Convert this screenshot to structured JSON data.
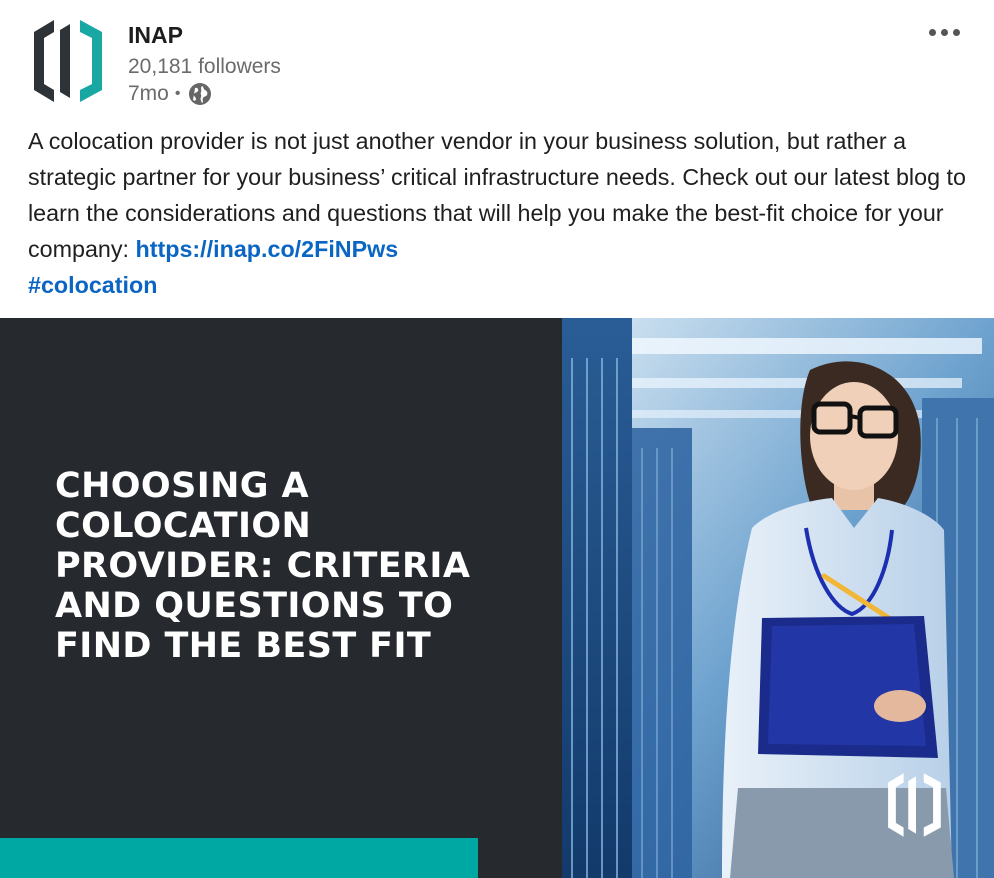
{
  "author": {
    "name": "INAP",
    "followers": "20,181 followers",
    "age": "7mo",
    "separator": "•",
    "visibility_icon": "globe-icon",
    "logo_icon": "inap-logo-icon"
  },
  "post": {
    "text": "A colocation provider is not just another vendor in your business solution, but rather a strategic partner for your business’ critical infrastructure needs. Check out our latest blog to learn the considerations and questions that will help you make the best-fit choice for your company: ",
    "link": "https://inap.co/2FiNPws",
    "hashtag": "#colocation"
  },
  "media": {
    "headline": "CHOOSING A COLOCATION PROVIDER: CRITERIA AND QUESTIONS TO FIND THE BEST FIT",
    "photo_description_icon": "woman-in-datacenter-photo",
    "brand_icon": "inap-logo-icon"
  },
  "menu": {
    "icon": "more-options-icon"
  },
  "colors": {
    "link": "#0a66c2",
    "panel_dark": "#262a2e",
    "accent_teal": "#00a8a4",
    "logo_dark": "#2e3338"
  }
}
